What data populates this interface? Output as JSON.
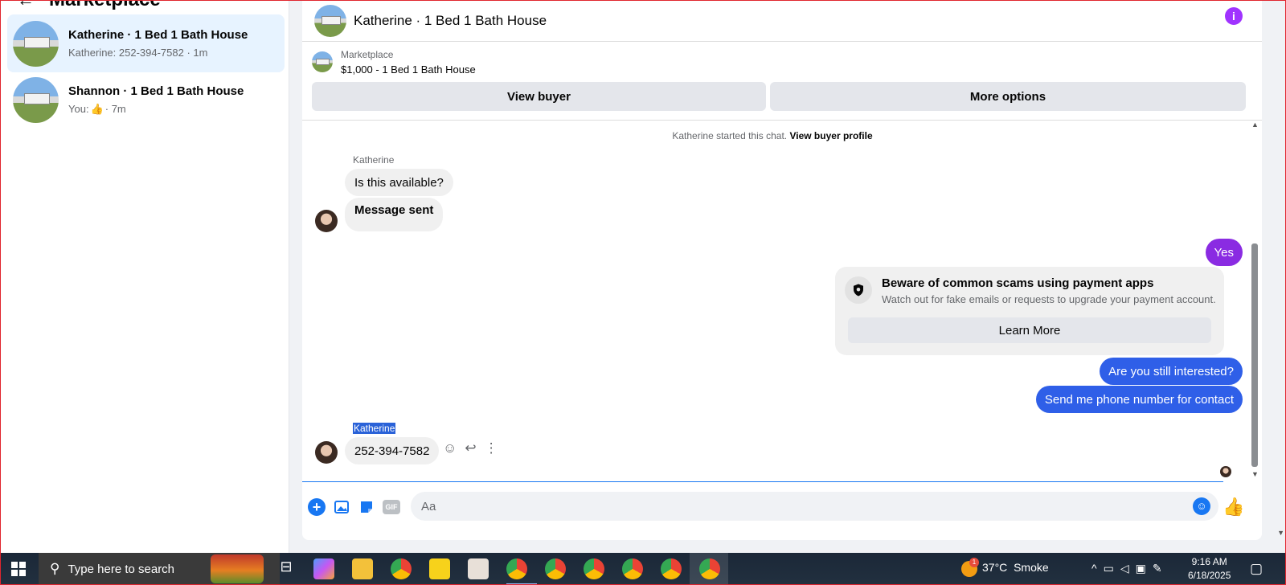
{
  "sidebar": {
    "back_icon": "arrow-left-icon",
    "title": "Marketplace",
    "conversations": [
      {
        "name": "Katherine · 1 Bed 1 Bath House",
        "preview": "Katherine: 252-394-7582 · 1m",
        "active": true
      },
      {
        "name": "Shannon · 1 Bed 1 Bath House",
        "preview_prefix": "You:",
        "preview_icon": "thumbs-up-icon",
        "preview_suffix": "· 7m",
        "active": false
      }
    ]
  },
  "chat": {
    "title": "Katherine · 1 Bed 1 Bath House",
    "info_icon": "info-icon",
    "listing": {
      "category": "Marketplace",
      "price_title": "$1,000 - 1 Bed 1 Bath House",
      "view_buyer": "View buyer",
      "more_options": "More options"
    },
    "system": {
      "text": "Katherine started this chat.",
      "link": "View buyer profile"
    },
    "messages": {
      "sender1": "Katherine",
      "in1": "Is this available?",
      "in2": "Message sent",
      "out1": "Yes",
      "out2": "Are you still interested?",
      "out3": "Send me phone number for contact",
      "sender2": "Katherine",
      "in3": "252-394-7582"
    },
    "scam_card": {
      "title": "Beware of common scams using payment apps",
      "description": "Watch out for fake emails or requests to upgrade your payment account.",
      "button": "Learn More"
    },
    "composer": {
      "placeholder": "Aa"
    },
    "colors": {
      "out_purple": "#8a2be2",
      "out_blue": "#2f5fe8",
      "accent": "#1877f2"
    }
  },
  "taskbar": {
    "search_placeholder": "Type here to search",
    "weather_temp": "37°C",
    "weather_text": "Smoke",
    "weather_badge": "1",
    "time": "9:16 AM",
    "date": "6/18/2025"
  }
}
